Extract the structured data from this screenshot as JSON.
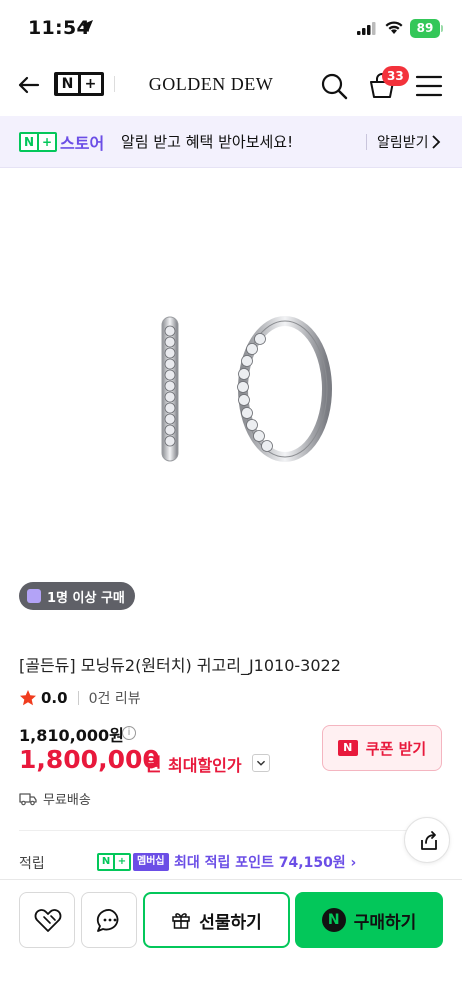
{
  "status_bar": {
    "time": "11:54",
    "battery": "89"
  },
  "header": {
    "brand": "GOLDEN DEW",
    "cart_count": "33",
    "logo_n": "N",
    "logo_plus": "+"
  },
  "banner": {
    "store": "스토어",
    "message": "알림 받고 혜택 받아보세요!",
    "action": "알림받기"
  },
  "product": {
    "buy_chip": "1명 이상 구매",
    "title": "[골든듀] 모닝듀2(원터치) 귀고리_J1010-3022",
    "rating": "0.0",
    "reviews": "0건 리뷰",
    "original_price": "1,810,000원",
    "sale_price": "1,800,000",
    "sale_currency": "원",
    "sale_label": "최대할인가",
    "coupon_label": "쿠폰 받기",
    "shipping": "무료배송",
    "points_label": "적립",
    "membership_badge": "멤버십",
    "points_text": "최대 적립 포인트 74,150원 ›"
  },
  "bottom_bar": {
    "gift_label": "선물하기",
    "buy_label": "구매하기"
  },
  "colors": {
    "naver_green": "#03c75a",
    "accent_purple": "#6b4ee6",
    "price_red": "#e8193c",
    "badge_red": "#f3323b"
  }
}
